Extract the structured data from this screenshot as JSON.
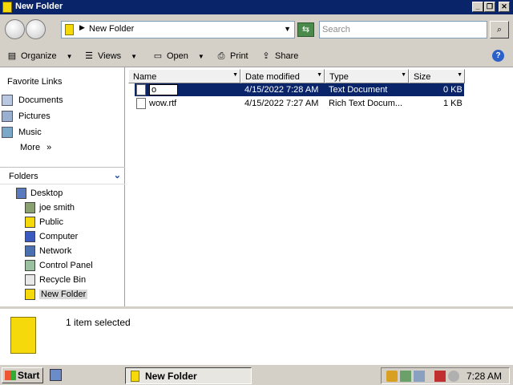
{
  "window": {
    "title": "New Folder",
    "controls": {
      "minimize": "_",
      "restore": "❐",
      "close": "✕"
    }
  },
  "address": {
    "path": "New Folder",
    "search_placeholder": "Search"
  },
  "toolbar": {
    "organize": "Organize",
    "views": "Views",
    "open": "Open",
    "print": "Print",
    "share": "Share",
    "help": "?"
  },
  "favorites": {
    "title": "Favorite Links",
    "items": [
      "Documents",
      "Pictures",
      "Music"
    ],
    "more": "More",
    "more_glyph": "»"
  },
  "folders": {
    "title": "Folders",
    "tree": [
      "Desktop",
      "joe smith",
      "Public",
      "Computer",
      "Network",
      "Control Panel",
      "Recycle Bin",
      "New Folder"
    ]
  },
  "columns": [
    "Name",
    "Date modified",
    "Type",
    "Size"
  ],
  "files": [
    {
      "name": "o",
      "date": "4/15/2022 7:28 AM",
      "type": "Text Document",
      "size": "0 KB"
    },
    {
      "name": "wow.rtf",
      "date": "4/15/2022 7:27 AM",
      "type": "Rich Text Docum...",
      "size": "1 KB"
    }
  ],
  "details": {
    "status": "1 item selected"
  },
  "taskbar": {
    "start": "Start",
    "task": "New Folder",
    "clock": "7:28 AM"
  }
}
